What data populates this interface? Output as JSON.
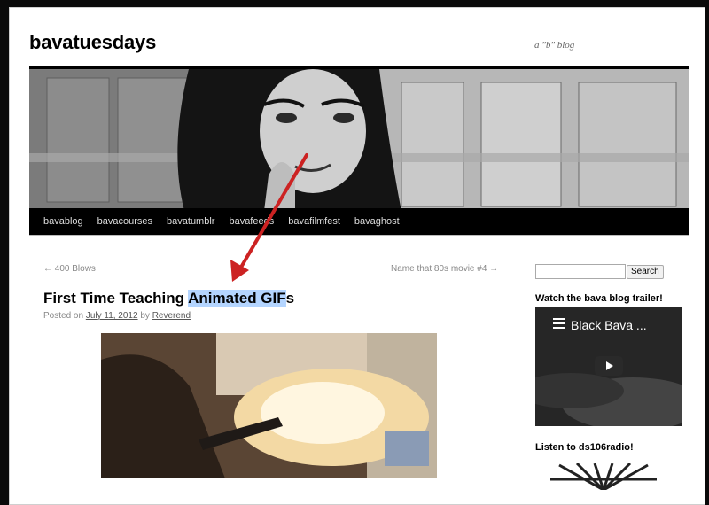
{
  "site": {
    "title": "bavatuesdays",
    "tagline": "a \"b\" blog"
  },
  "nav": {
    "items": [
      "bavablog",
      "bavacourses",
      "bavatumblr",
      "bavafeeds",
      "bavafilmfest",
      "bavaghost"
    ]
  },
  "post_nav": {
    "prev": "← 400 Blows",
    "next": "Name that 80s movie #4 →"
  },
  "post": {
    "title_before": "First Time Teaching ",
    "title_highlight": "Animated GIF",
    "title_after": "s",
    "meta_prefix": "Posted on ",
    "date": "July 11, 2012",
    "meta_by": " by ",
    "author": "Reverend"
  },
  "sidebar": {
    "search_button": "Search",
    "trailer_title": "Watch the bava blog trailer!",
    "video_title": "Black Bava ...",
    "radio_title": "Listen to ds106radio!"
  },
  "annotation": {
    "arrow_color": "#cc2222"
  }
}
